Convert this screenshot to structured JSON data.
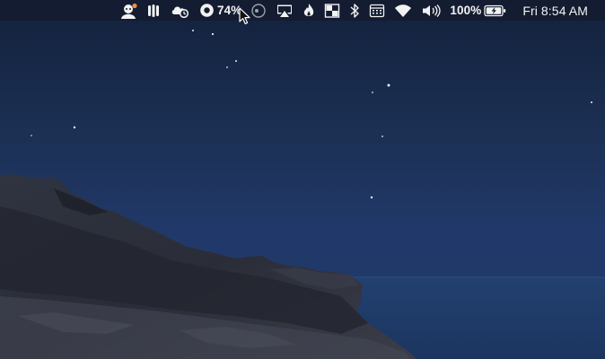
{
  "menubar": {
    "istat_percent": "74%",
    "battery_percent": "100%",
    "clock": "Fri 8:54 AM"
  },
  "icons": [
    "notification-avatar-icon",
    "columns-app-icon",
    "cloud-sync-icon",
    "record-circle-icon",
    "focus-circle-icon",
    "airplay-icon",
    "flame-icon",
    "grid-app-icon",
    "bluetooth-icon",
    "calendar-app-icon",
    "wifi-icon",
    "volume-icon",
    "battery-charging-icon"
  ],
  "colors": {
    "sky_top": "#13213c",
    "sky_bottom": "#203a66",
    "sea": "#223f6e",
    "rock": "#2a2e3a",
    "menubar": "#141c30",
    "notification_dot": "#ff8a3c"
  }
}
